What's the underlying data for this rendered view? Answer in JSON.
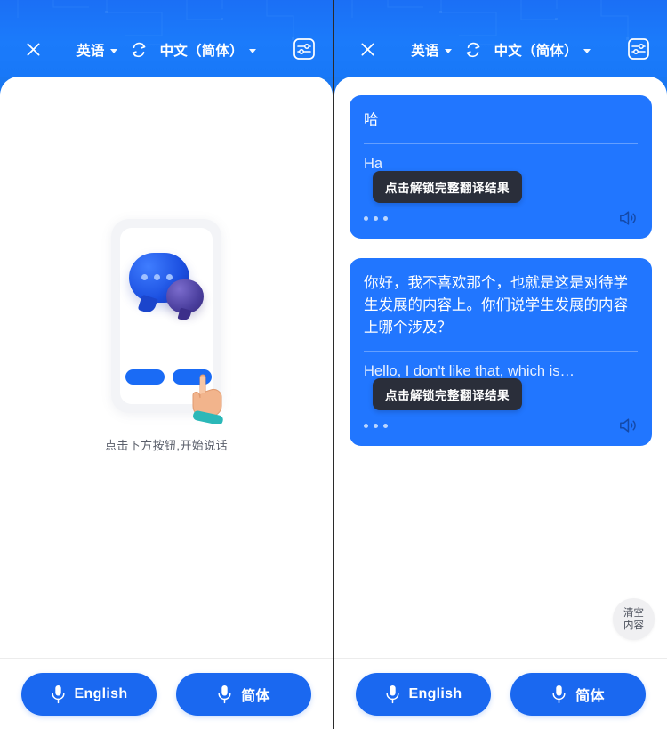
{
  "app": {
    "accent_blue": "#1877F2",
    "bubble_blue": "#2176FF",
    "tooltip_dark": "#2a2e3a"
  },
  "header": {
    "close_label": "×",
    "source_lang": "英语",
    "target_lang": "中文（简体）",
    "swap_icon": "swap-languages-icon",
    "settings_icon": "settings-sliders-icon"
  },
  "left_panel": {
    "empty_state": {
      "hint": "点击下方按钮,开始说话",
      "illustration": "phone-with-chat-bubbles-and-hand-illustration"
    }
  },
  "right_panel": {
    "messages": [
      {
        "source": "哈",
        "translation": "Ha",
        "unlock_label": "点击解锁完整翻译结果",
        "more_icon": "more-dots-icon",
        "speaker_icon": "speaker-icon"
      },
      {
        "source": "你好，我不喜欢那个，也就是这是对待学生发展的内容上。你们说学生发展的内容上哪个涉及？",
        "translation": "Hello, I don't like that, which is…",
        "unlock_label": "点击解锁完整翻译结果",
        "more_icon": "more-dots-icon",
        "speaker_icon": "speaker-icon"
      }
    ],
    "clear_button": {
      "line1": "清空",
      "line2": "内容"
    }
  },
  "bottom_bar": {
    "left_button": {
      "label": "English",
      "icon": "microphone-icon"
    },
    "right_button": {
      "label": "简体",
      "icon": "microphone-icon"
    }
  }
}
